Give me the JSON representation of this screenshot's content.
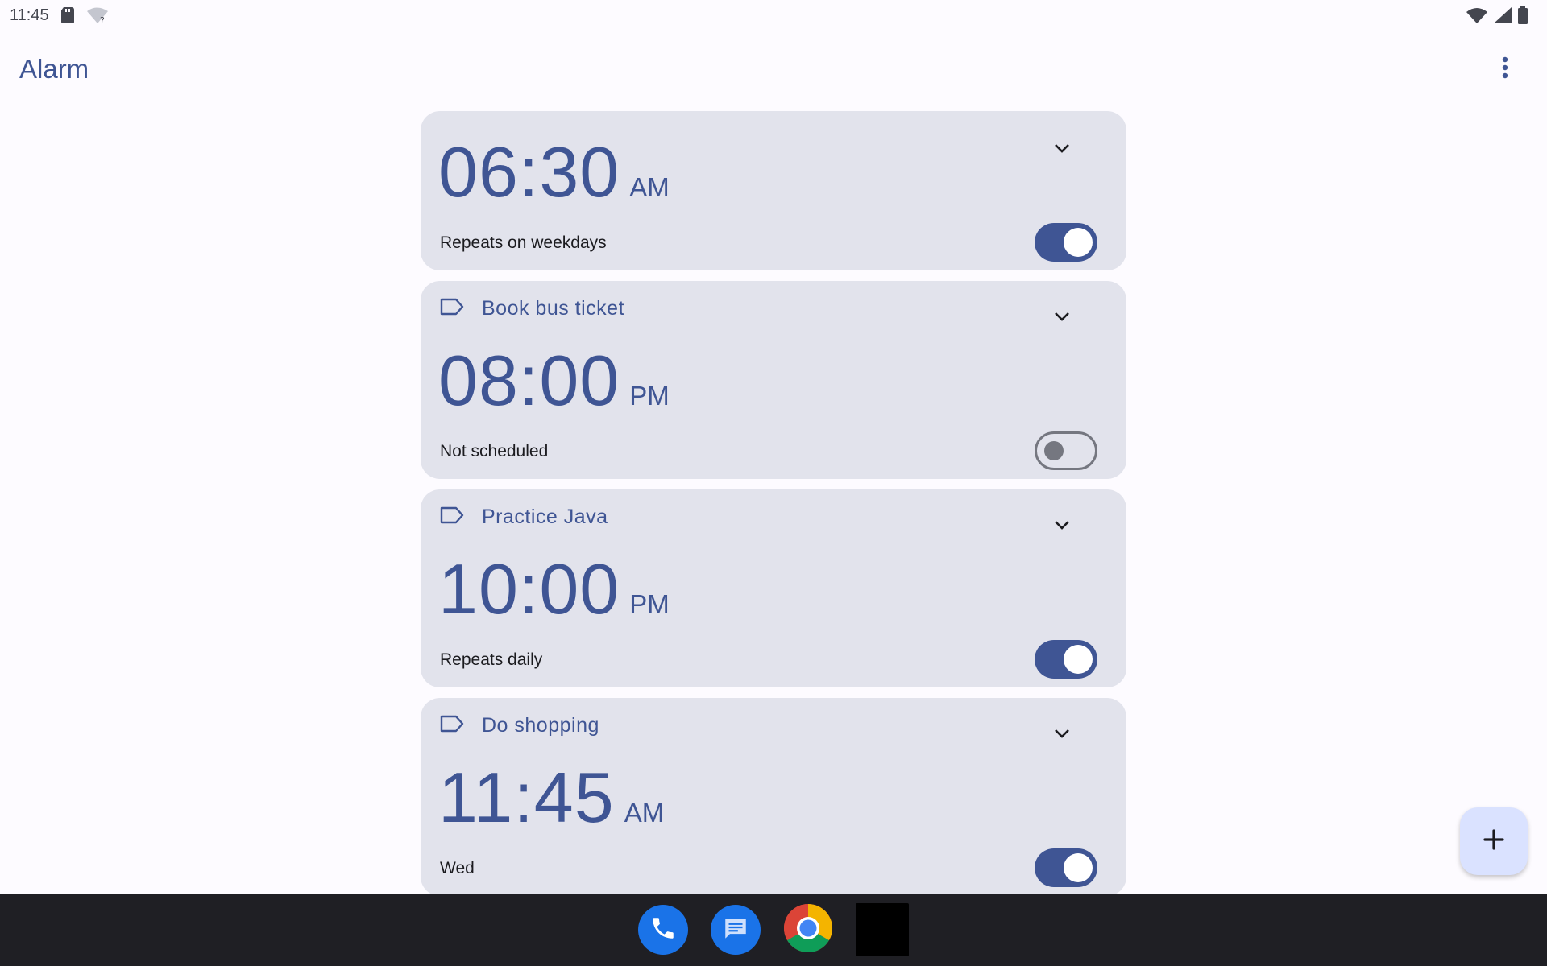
{
  "status_bar": {
    "time": "11:45",
    "left_icons": [
      "sd-card-icon",
      "wifi-question-icon"
    ],
    "right_icons": [
      "wifi-icon",
      "signal-icon",
      "battery-icon"
    ]
  },
  "app_bar": {
    "title": "Alarm",
    "menu_icon": "more-vert-icon"
  },
  "alarms": [
    {
      "label": "",
      "time": "06:30",
      "ampm": "AM",
      "schedule": "Repeats on weekdays",
      "enabled": true
    },
    {
      "label": "Book bus ticket",
      "time": "08:00",
      "ampm": "PM",
      "schedule": "Not scheduled",
      "enabled": false
    },
    {
      "label": "Practice Java",
      "time": "10:00",
      "ampm": "PM",
      "schedule": "Repeats daily",
      "enabled": true
    },
    {
      "label": "Do shopping",
      "time": "11:45",
      "ampm": "AM",
      "schedule": "Wed",
      "enabled": true
    }
  ],
  "fab": {
    "icon": "add-icon"
  },
  "taskbar": {
    "apps": [
      "phone-icon",
      "messages-icon",
      "chrome-icon",
      "black-app-icon"
    ]
  },
  "colors": {
    "accent": "#3f5594",
    "card": "#e2e3ec",
    "background": "#fdfbff",
    "taskbar": "#1f1f24"
  }
}
